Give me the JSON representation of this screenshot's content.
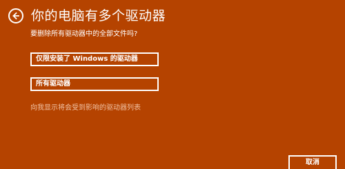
{
  "header": {
    "back_icon": "back-arrow-icon",
    "title": "你的电脑有多个驱动器"
  },
  "prompt": {
    "question": "要删除所有驱动器中的全部文件吗?"
  },
  "options": [
    {
      "label": "仅限安装了 Windows 的驱动器"
    },
    {
      "label": "所有驱动器"
    }
  ],
  "link": {
    "label": "向我显示将会受到影响的驱动器列表"
  },
  "footer": {
    "cancel_label": "取消"
  },
  "colors": {
    "background": "#b54300",
    "text": "#ffffff",
    "link": "#f1c2a3"
  }
}
